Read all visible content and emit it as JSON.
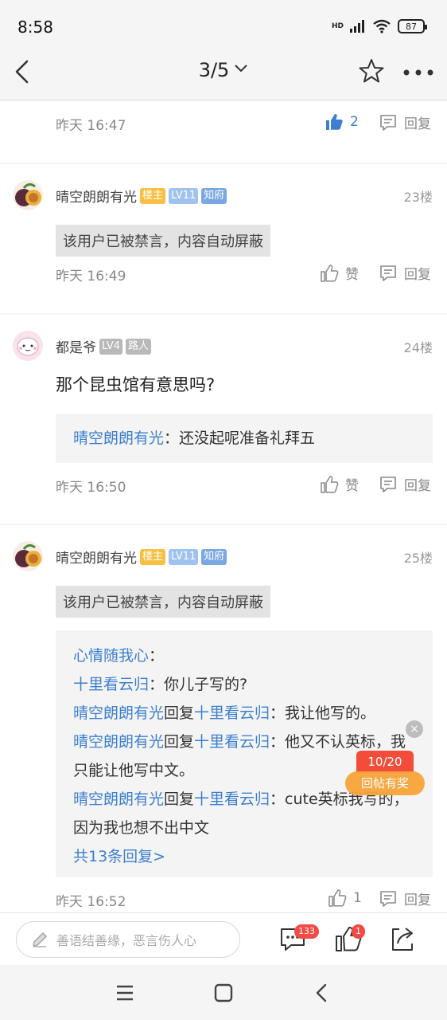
{
  "status_bar": {
    "time": "8:58",
    "signal_label": "HD",
    "battery": "87"
  },
  "nav": {
    "page_indicator": "3/5"
  },
  "posts": [
    {
      "time": "昨天 16:47",
      "like_count": "2",
      "reply_label": "回复"
    },
    {
      "user": "晴空朗朗有光",
      "badges": [
        "楼主",
        "LV11",
        "知府"
      ],
      "floor": "23楼",
      "muted_text": "该用户已被禁言，内容自动屏蔽",
      "time": "昨天 16:49",
      "like_label": "赞",
      "reply_label": "回复"
    },
    {
      "user": "都是爷",
      "badges": [
        "LV4",
        "路人"
      ],
      "floor": "24楼",
      "content": "那个昆虫馆有意思吗?",
      "quote_user": "晴空朗朗有光",
      "quote_sep": "：",
      "quote_text": "还没起呢准备礼拜五",
      "time": "昨天 16:50",
      "like_label": "赞",
      "reply_label": "回复"
    },
    {
      "user": "晴空朗朗有光",
      "badges": [
        "楼主",
        "LV11",
        "知府"
      ],
      "floor": "25楼",
      "muted_text": "该用户已被禁言，内容自动屏蔽",
      "subreplies": [
        {
          "user": "心情随我心",
          "mid": "",
          "target": "",
          "text": "："
        },
        {
          "user": "十里看云归",
          "mid": "",
          "target": "",
          "text": "：你儿子写的?"
        },
        {
          "user": "晴空朗朗有光",
          "mid": "回复",
          "target": "十里看云归",
          "text": "：我让他写的。"
        },
        {
          "user": "晴空朗朗有光",
          "mid": "回复",
          "target": "十里看云归",
          "text": "：他又不认英标，我只能让他写中文。"
        },
        {
          "user": "晴空朗朗有光",
          "mid": "回复",
          "target": "十里看云归",
          "text": "：cute英标我写的，因为我也想不出中文"
        }
      ],
      "more_replies": "共13条回复>",
      "time": "昨天 16:52",
      "like_count": "1",
      "reply_label": "回复"
    }
  ],
  "reward": {
    "close": "×",
    "count": "10/20",
    "label": "回帖有奖"
  },
  "bottom_bar": {
    "placeholder": "善语结善缘，恶言伤人心",
    "comment_badge": "133",
    "like_badge": "1"
  },
  "colors": {
    "accent_blue": "#3d7fd0",
    "badge_red": "#f24a44",
    "owner_badge": "#f7c043"
  }
}
